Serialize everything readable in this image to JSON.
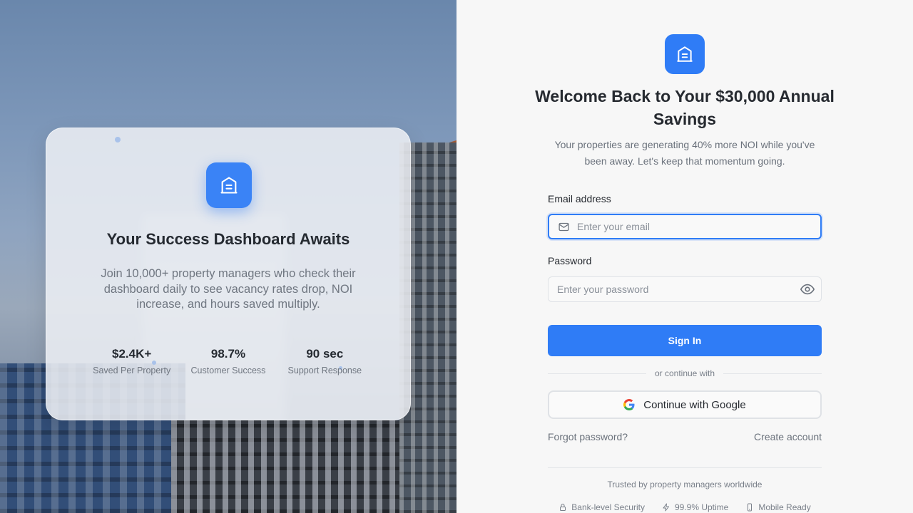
{
  "left_panel": {
    "card": {
      "title": "Your Success Dashboard Awaits",
      "description": "Join 10,000+ property managers who check their dashboard daily to see vacancy rates drop, NOI increase, and hours saved multiply.",
      "stats": [
        {
          "value": "$2.4K+",
          "label": "Saved Per Property"
        },
        {
          "value": "98.7%",
          "label": "Customer Success"
        },
        {
          "value": "90 sec",
          "label": "Support Response"
        }
      ]
    }
  },
  "login": {
    "title": "Welcome Back to Your $30,000 Annual Savings",
    "subtitle": "Your properties are generating 40% more NOI while you've been away. Let's keep that momentum going.",
    "email": {
      "label": "Email address",
      "placeholder": "Enter your email",
      "value": ""
    },
    "password": {
      "label": "Password",
      "placeholder": "Enter your password",
      "value": ""
    },
    "sign_in_label": "Sign In",
    "divider_text": "or continue with",
    "google_label": "Continue with Google",
    "forgot_password": "Forgot password?",
    "create_account": "Create account",
    "trusted_text": "Trusted by property managers worldwide",
    "badges": [
      {
        "icon": "lock-icon",
        "label": "Bank-level Security"
      },
      {
        "icon": "lightning-icon",
        "label": "99.9% Uptime"
      },
      {
        "icon": "phone-icon",
        "label": "Mobile Ready"
      }
    ]
  },
  "colors": {
    "accent": "#2f7cf6",
    "card_bg": "#eef0f4",
    "text": "#262a30"
  }
}
